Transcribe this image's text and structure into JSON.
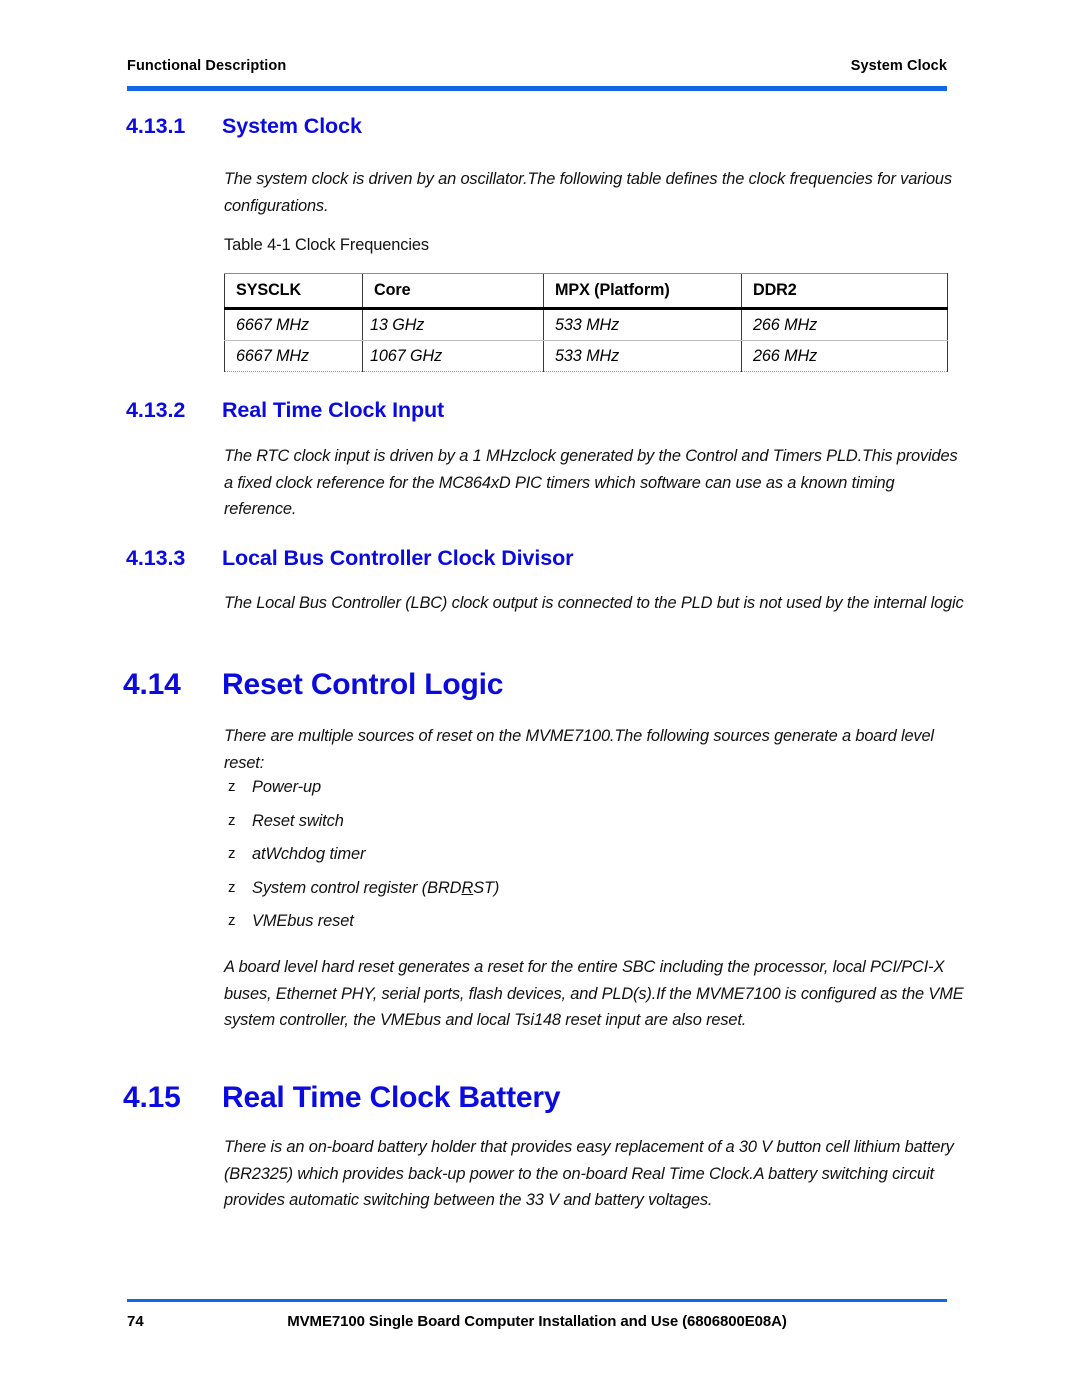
{
  "header": {
    "left": "Functional Description",
    "right": "System Clock"
  },
  "sections": {
    "s4_13_1": {
      "number": "4.13.1",
      "title": "System Clock",
      "paragraph": "The system clock is driven by an oscillator.The  following table defines the clock frequencies for various configurations."
    },
    "s4_13_2": {
      "number": "4.13.2",
      "title": "Real Time Clock Input",
      "paragraph": "The RTC clock input is driven by a 1 MHzclock generated by the Control and Timers PLD.This provides a fixed clock reference for the MC864xD PIC timers which software can use as a known timing reference."
    },
    "s4_13_3": {
      "number": "4.13.3",
      "title": "Local Bus Controller Clock Divisor",
      "paragraph": "The Local Bus Controller (LBC) clock output is connected to the PLD but is not used by the internal logic"
    },
    "s4_14": {
      "number": "4.14",
      "title": "Reset Control Logic",
      "intro": "There are multiple sources of reset on the MVME7100.The following sources generate a board level reset:",
      "bullet_marker": "z",
      "bullets": [
        "Power-up",
        "Reset switch",
        "atWchdog timer",
        "System control register (BRD",
        "VMEbus reset"
      ],
      "bullet_brdrst_underlined": "R",
      "bullet_brdrst_tail": "ST)",
      "closing": "A board level hard reset generates a reset for the entire SBC including the processor, local PCI/PCI-X buses, Ethernet PHY, serial ports,    flash devices, and PLD(s).If the MVME7100 is configured as the VME system controller, the VMEbus and local Tsi148 reset input are also reset."
    },
    "s4_15": {
      "number": "4.15",
      "title": "Real Time Clock Battery",
      "paragraph": "There is an on-board battery holder that provides easy replacement of a 30 V button cell lithium battery (BR2325) which provides back-up power to the on-board Real Time Clock.A battery switching circuit provides automatic switching between the 33 V and battery voltages."
    }
  },
  "table": {
    "caption": "Table 4-1 Clock Frequencies",
    "columns": [
      "SYSCLK",
      "Core",
      "MPX (Platform)",
      "DDR2"
    ],
    "rows": [
      [
        "6667 MHz",
        "13 GHz",
        "533 MHz",
        "266 MHz"
      ],
      [
        "6667 MHz",
        "1067 GHz",
        "533 MHz",
        "266 MHz"
      ]
    ]
  },
  "footer": {
    "page_number": "74",
    "document_title": "MVME7100 Single Board Computer Installation and Use (6806800E08A)"
  },
  "colors": {
    "heading_blue": "#0B0BE0",
    "rule_blue": "#1565E8",
    "text_black": "#111111"
  }
}
